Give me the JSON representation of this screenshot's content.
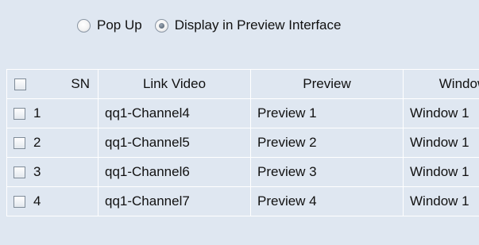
{
  "display_mode": {
    "options": [
      {
        "label": "Pop Up",
        "selected": false
      },
      {
        "label": "Display in Preview Interface",
        "selected": true
      }
    ]
  },
  "table": {
    "columns": [
      "SN",
      "Link Video",
      "Preview",
      "Window"
    ],
    "rows": [
      {
        "sn": "1",
        "link_video": "qq1-Channel4",
        "preview": "Preview 1",
        "window": "Window 1"
      },
      {
        "sn": "2",
        "link_video": "qq1-Channel5",
        "preview": "Preview 2",
        "window": "Window 1"
      },
      {
        "sn": "3",
        "link_video": "qq1-Channel6",
        "preview": "Preview 3",
        "window": "Window 1"
      },
      {
        "sn": "4",
        "link_video": "qq1-Channel7",
        "preview": "Preview 4",
        "window": "Window 1"
      }
    ]
  }
}
